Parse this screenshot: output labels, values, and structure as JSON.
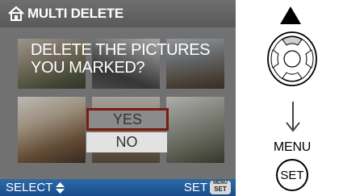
{
  "screen": {
    "title": "MULTI DELETE",
    "home_icon": "home-icon",
    "message_line1": "DELETE THE PICTURES",
    "message_line2": "YOU MARKED?",
    "options": {
      "yes": "YES",
      "no": "NO",
      "selected": "YES"
    },
    "footer": {
      "select_label": "SELECT",
      "set_label": "SET",
      "menu_small": "MENU",
      "set_small": "SET"
    },
    "colors": {
      "title_bg": "#616161",
      "footer_bg": "#1f5a98",
      "selected_border": "#7a1b12"
    }
  },
  "controls": {
    "up_icon": "up-triangle-icon",
    "dpad_icon": "dpad-icon",
    "arrow_icon": "arrow-down-icon",
    "menu_label": "MENU",
    "set_button_label": "SET"
  }
}
